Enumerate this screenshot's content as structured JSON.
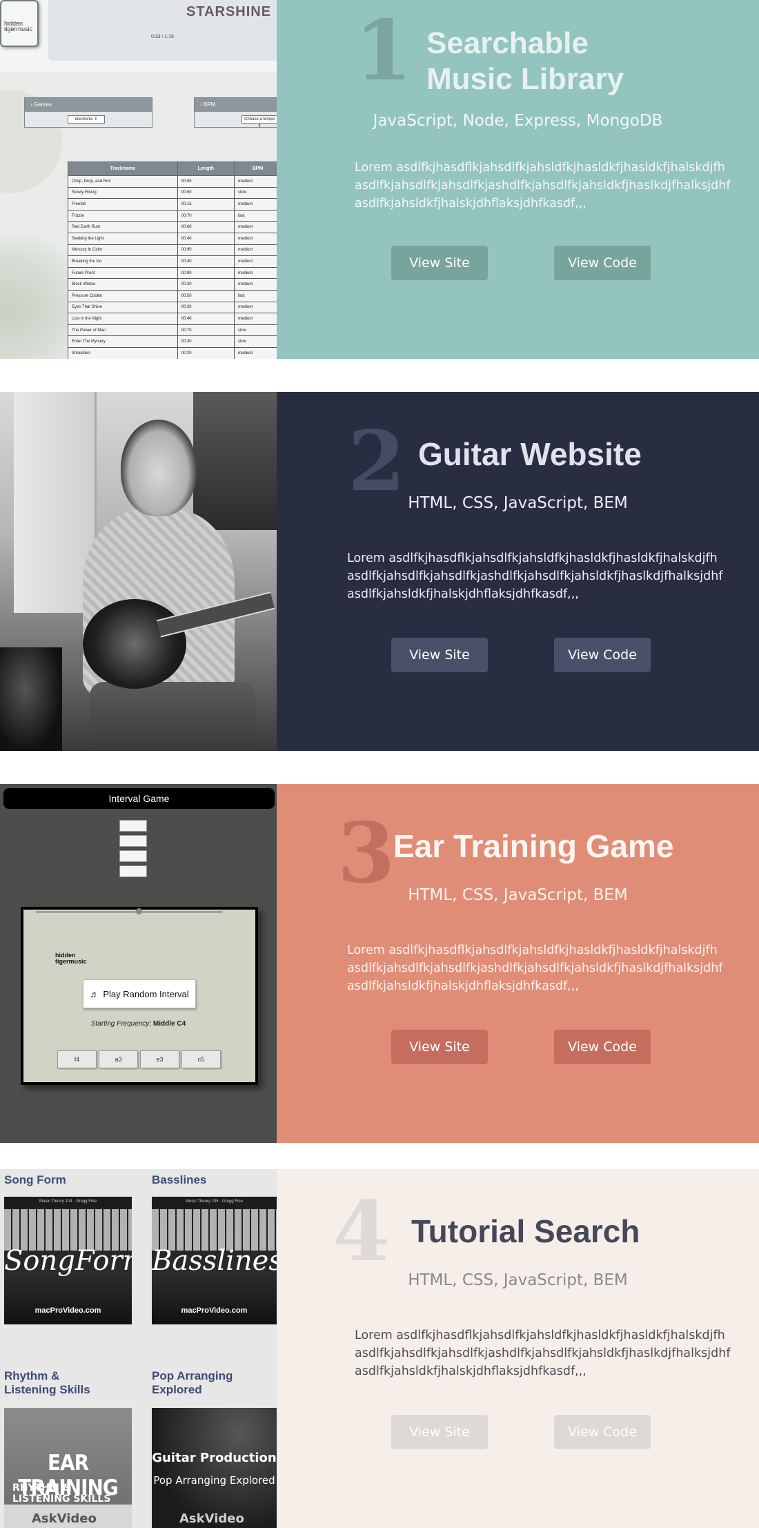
{
  "projects": [
    {
      "number": "1",
      "title_line1": "Searchable",
      "title_line2": "Music Library",
      "tech": "JavaScript, Node, Express, MongoDB",
      "description": "Lorem asdlfkjhasdflkjahsdlfkjahsldfkjhasldkfjhasldkfjhalskdjfh asdlfkjahsdlfkjahsdlfkjashdlfkjahsdlfkjahsldkfjhaslkdjfhalksjdhf asdlfkjahsldkfjhalskjdhflaksjdhfkasdf,,,",
      "view_site": "View Site",
      "view_code": "View Code",
      "colors": {
        "panel": "#93c4bf",
        "number": "#7ba59e",
        "title": "#e8f1ef",
        "text": "#f5f9f8",
        "button": "#78a49c"
      },
      "screenshot": {
        "song_title": "STARSHINE",
        "time": "0:33 / 1:16",
        "logo_text": "hidden tigermusic",
        "genre_label": "Genres",
        "genre_value": "electronic",
        "bpm_label": "BPM",
        "bpm_value": "Choose a tempo",
        "columns": [
          "Trackname",
          "Length",
          "BPM"
        ],
        "rows": [
          [
            "Chop, Drop, and Roll",
            "00:50",
            "medium"
          ],
          [
            "Slowly Rising",
            "00:60",
            "slow"
          ],
          [
            "Freefall",
            "00:15",
            "medium"
          ],
          [
            "Frizzle",
            "00:70",
            "fast"
          ],
          [
            "Red Earth Rust",
            "00:60",
            "medium"
          ],
          [
            "Seeking the Light",
            "00:40",
            "medium"
          ],
          [
            "Mercury In Color",
            "00:90",
            "medium"
          ],
          [
            "Breaking the Ice",
            "00:40",
            "medium"
          ],
          [
            "Future Proof",
            "00:80",
            "medium"
          ],
          [
            "Block Widow",
            "00:30",
            "medium"
          ],
          [
            "Pressure Cookin",
            "00:50",
            "fast"
          ],
          [
            "Eyes That Shine",
            "00:30",
            "medium"
          ],
          [
            "Lost in the Night",
            "00:40",
            "medium"
          ],
          [
            "The Power of Man",
            "00:70",
            "slow"
          ],
          [
            "Enter The Mystery",
            "00:30",
            "slow"
          ],
          [
            "Shoulders",
            "00:20",
            "medium"
          ]
        ]
      }
    },
    {
      "number": "2",
      "title": "Guitar Website",
      "tech": "HTML, CSS, JavaScript, BEM",
      "description": "Lorem asdlfkjhasdflkjahsdlfkjahsldfkjhasldkfjhasldkfjhalskdjfh asdlfkjahsdlfkjahsdlfkjashdlfkjahsdlfkjahsldkfjhaslkdjfhalksjdhf asdlfkjahsldkfjhalskjdhflaksjdhfkasdf,,,",
      "view_site": "View Site",
      "view_code": "View Code",
      "colors": {
        "panel": "#292d42",
        "number": "#454b64",
        "title": "#dfe3ec",
        "text": "#eef0f5",
        "button": "#4b506a"
      }
    },
    {
      "number": "3",
      "title": "Ear Training Game",
      "tech": "HTML, CSS, JavaScript, BEM",
      "description": "Lorem asdlfkjhasdflkjahsdlfkjahsldfkjhasldkfjhasldkfjhalskdjfh asdlfkjahsdlfkjahsdlfkjashdlfkjahsdlfkjahsldkfjhaslkdjfhalksjdhf asdlfkjahsldkfjhalskjdhflaksjdhfkasdf,,,",
      "view_site": "View Site",
      "view_code": "View Code",
      "colors": {
        "panel": "#e08d78",
        "number": "#c1705f",
        "title": "#fff6f2",
        "text": "#fff4ef",
        "button": "#c66e5d"
      },
      "screenshot": {
        "header": "Interval Game",
        "logo_text": "hidden tigermusic",
        "play_label": "Play Random Interval",
        "freq_label": "Starting Frequency:",
        "freq_value": "Middle C4",
        "answers": [
          "f4",
          "a3",
          "e3",
          "c5"
        ]
      }
    },
    {
      "number": "4",
      "title": "Tutorial Search",
      "tech": "HTML, CSS, JavaScript, BEM",
      "description": "Lorem asdlfkjhasdflkjahsdlfkjahsldfkjhasldkfjhasldkfjhalskdjfh asdlfkjahsdlfkjahsdlfkjashdlfkjahsdlfkjahsldkfjhaslkdjfhalksjdhf asdlfkjahsldkfjhalskjdhflaksjdhfkasdf,,,",
      "view_site": "View Site",
      "view_code": "View Code",
      "colors": {
        "panel": "#f6efe9",
        "number": "#dedad5",
        "title": "#45475a",
        "text": "#4d4d55",
        "tech": "#8a8a8a",
        "button": "#dddad6"
      },
      "screenshot": {
        "items": [
          {
            "label": "Song Form",
            "cover": "SongForm",
            "caption": "Music Theory 104  ·  Gregg Fine",
            "brand": "macProVideo.com"
          },
          {
            "label": "Basslines",
            "cover": "Basslines",
            "caption": "Music Theory 105  ·  Gregg Fine",
            "brand": "macProVideo.com"
          },
          {
            "label": "Rhythm & Listening Skills",
            "cover_title": "EAR TRAINING",
            "cover_sub": "RHYTHM & LISTENING SKILLS",
            "brand": "AskVideo"
          },
          {
            "label": "Pop Arranging Explored",
            "cover_title": "Guitar Production",
            "cover_sub": "Pop Arranging Explored",
            "brand": "AskVideo"
          }
        ]
      }
    }
  ]
}
